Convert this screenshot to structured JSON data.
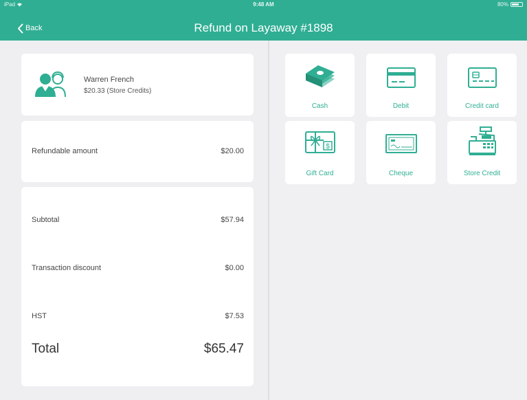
{
  "status_bar": {
    "carrier": "iPad",
    "time": "9:48 AM",
    "battery": "80%"
  },
  "nav": {
    "back_label": "Back",
    "title": "Refund on Layaway #1898"
  },
  "customer": {
    "name": "Warren French",
    "credit": "$20.33  (Store Credits)"
  },
  "refund": {
    "label": "Refundable amount",
    "value": "$20.00"
  },
  "totals": {
    "subtotal_label": "Subtotal",
    "subtotal_value": "$57.94",
    "discount_label": "Transaction discount",
    "discount_value": "$0.00",
    "tax_label": "HST",
    "tax_value": "$7.53",
    "total_label": "Total",
    "total_value": "$65.47"
  },
  "payment_methods": [
    {
      "label": "Cash",
      "icon": "cash-icon"
    },
    {
      "label": "Debit",
      "icon": "debit-card-icon"
    },
    {
      "label": "Credit card",
      "icon": "credit-card-icon"
    },
    {
      "label": "Gift Card",
      "icon": "gift-card-icon"
    },
    {
      "label": "Cheque",
      "icon": "cheque-icon"
    },
    {
      "label": "Store Credit",
      "icon": "cash-register-icon"
    }
  ],
  "colors": {
    "accent": "#2fae93",
    "background": "#efeff2",
    "card": "#ffffff"
  }
}
